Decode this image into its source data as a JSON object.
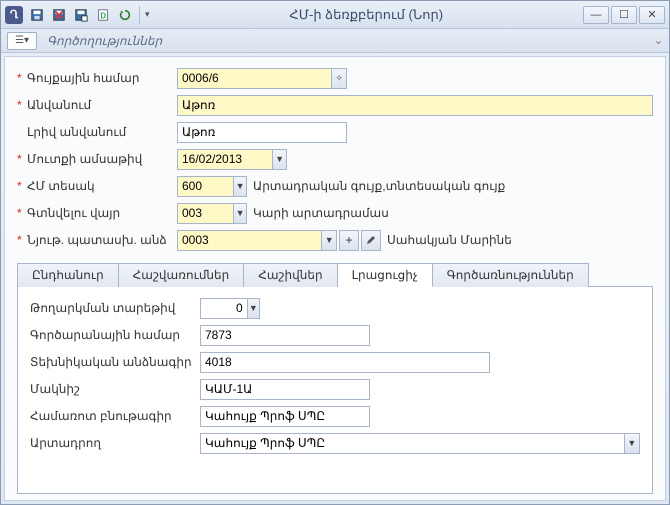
{
  "window": {
    "title": "ՀՄ-ի ձեռքբերում (Նոր)"
  },
  "ribbon": {
    "section": "Գործողություններ"
  },
  "fields": {
    "inventory_number": {
      "label": "Գույքային համար",
      "value": "0006/6",
      "required": true
    },
    "name": {
      "label": "Անվանում",
      "value": "Աթոռ",
      "required": true
    },
    "full_name": {
      "label": "Լրիվ անվանում",
      "value": "Աթոռ",
      "required": false
    },
    "entry_date": {
      "label": "Մուտքի ամսաթիվ",
      "value": "16/02/2013",
      "required": true
    },
    "hm_type": {
      "label": "ՀՄ տեսակ",
      "value": "600",
      "suffix": "Արտադրական գույք,տնտեսական գույք",
      "required": true
    },
    "location": {
      "label": "Գտնվելու վայր",
      "value": "003",
      "suffix": "Կարի արտադրամաս",
      "required": true
    },
    "responsible": {
      "label": "Նյութ. պատասխ. անձ",
      "value": "0003",
      "suffix": "Սահակյան Մարինե",
      "required": true
    }
  },
  "tabs": [
    {
      "id": "general",
      "label": "Ընդհանուր"
    },
    {
      "id": "accounts",
      "label": "Հաշվառումներ"
    },
    {
      "id": "invoices",
      "label": "Հաշիվներ"
    },
    {
      "id": "additional",
      "label": "Լրացուցիչ"
    },
    {
      "id": "operations",
      "label": "Գործառնություններ"
    }
  ],
  "active_tab": "additional",
  "additional": {
    "release_year": {
      "label": "Թողարկման տարեթիվ",
      "value": "0"
    },
    "factory_no": {
      "label": "Գործարանային համար",
      "value": "7873"
    },
    "tech_passport": {
      "label": "Տեխնիկական անձնագիր",
      "value": "4018"
    },
    "brand": {
      "label": "Մակնիշ",
      "value": "ԿԱՄ-1Ա"
    },
    "short_desc": {
      "label": "Համառոտ բնութագիր",
      "value": "Կահույք Պրոֆ ՍՊԸ"
    },
    "manufacturer": {
      "label": "Արտադրող",
      "value": "Կահույք Պրոֆ ՍՊԸ"
    }
  }
}
